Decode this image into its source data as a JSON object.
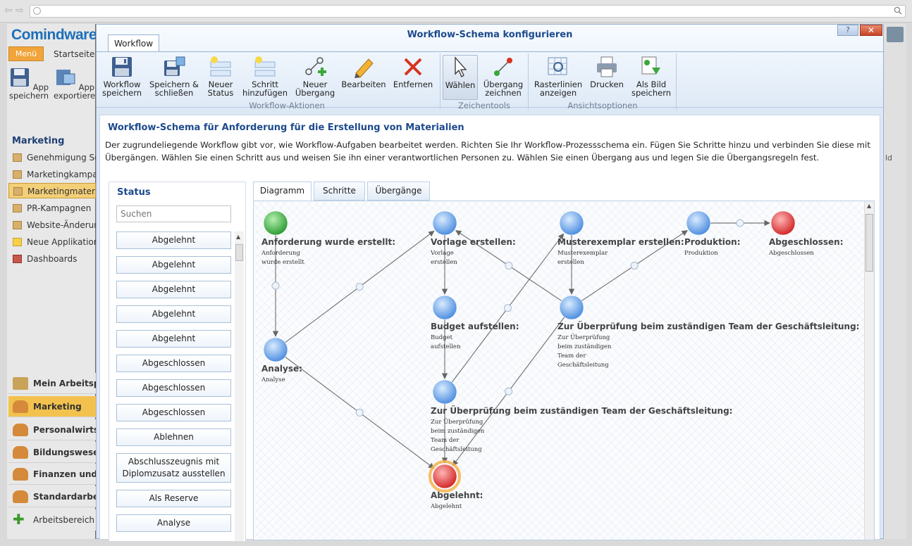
{
  "browser": {
    "url": ""
  },
  "bgapp": {
    "logo": "Comindware",
    "menu_tab": "Menü",
    "start_tab": "Startseite",
    "tools": [
      "App speichern",
      "App exportieren"
    ],
    "section_title": "Marketing",
    "nav_items": [
      "Genehmigung So",
      "Marketingkampa",
      "Marketingmateri",
      "PR-Kampagnen",
      "Website-Änderun",
      "Neue Applikation",
      "Dashboards"
    ],
    "bottom_items": [
      "Mein Arbeitsp",
      "Marketing",
      "Personalwirts",
      "Bildungswese",
      "Finanzen und",
      "Standardarbe",
      "Arbeitsbereich"
    ],
    "right_partial": "ld"
  },
  "dialog": {
    "title": "Workflow-Schema konfigurieren",
    "help_label": "?",
    "close_label": "✕",
    "ribbon_tab": "Workflow",
    "ribbon": {
      "groups": [
        "Workflow-Aktionen",
        "Zeichentools",
        "Ansichtsoptionen"
      ],
      "buttons": [
        [
          "Workflow",
          "speichern"
        ],
        [
          "Speichern &",
          "schließen"
        ],
        [
          "Neuer",
          "Status"
        ],
        [
          "Schritt",
          "hinzufügen"
        ],
        [
          "Neuer",
          "Übergang"
        ],
        [
          "Bearbeiten",
          ""
        ],
        [
          "Entfernen",
          ""
        ],
        [
          "Wählen",
          ""
        ],
        [
          "Übergang",
          "zeichnen"
        ],
        [
          "Rasterlinien",
          "anzeigen"
        ],
        [
          "Drucken",
          ""
        ],
        [
          "Als Bild",
          "speichern"
        ]
      ]
    },
    "content_title": "Workflow-Schema für Anforderung für die Erstellung von Materialien",
    "content_desc": "Der zugrundeliegende Workflow gibt vor, wie Workflow-Aufgaben bearbeitet werden. Richten Sie Ihr Workflow-Prozessschema ein. Fügen Sie Schritte hinzu und verbinden Sie diese mit Übergängen. Wählen Sie einen Schritt aus und weisen Sie ihn einer verantwortlichen Personen zu. Wählen Sie einen Übergang aus und legen Sie die Übergangsregeln fest.",
    "status_panel": {
      "title": "Status",
      "search_placeholder": "Suchen",
      "items": [
        "Abgelehnt",
        "Abgelehnt",
        "Abgelehnt",
        "Abgelehnt",
        "Abgelehnt",
        "Abgeschlossen",
        "Abgeschlossen",
        "Abgeschlossen",
        "Ablehnen",
        "Abschlusszeugnis mit Diplomzusatz ausstellen",
        "Als Reserve",
        "Analyse"
      ]
    },
    "tabs": [
      "Diagramm",
      "Schritte",
      "Übergänge"
    ],
    "diagram": {
      "nodes": [
        {
          "label": "Anforderung wurde erstellt:",
          "sub": [
            "Anforderung",
            "wurde erstellt"
          ],
          "kind": "start"
        },
        {
          "label": "Vorlage erstellen:",
          "sub": [
            "Vorlage",
            "erstellen"
          ],
          "kind": "step"
        },
        {
          "label": "Musterexemplar erstellen:",
          "sub": [
            "Musterexemplar",
            "erstellen"
          ],
          "kind": "step"
        },
        {
          "label": "Produktion:",
          "sub": [
            "Produktion"
          ],
          "kind": "step"
        },
        {
          "label": "Abgeschlossen:",
          "sub": [
            "Abgeschlossen"
          ],
          "kind": "end"
        },
        {
          "label": "Budget aufstellen:",
          "sub": [
            "Budget",
            "aufstellen"
          ],
          "kind": "step"
        },
        {
          "label": "Zur Überprüfung beim zuständigen Team der Geschäftsleitung:",
          "sub": [
            "Zur Überprüfung",
            "beim zuständigen",
            "Team der",
            "Geschäftsleitung"
          ],
          "kind": "step"
        },
        {
          "label": "Analyse:",
          "sub": [
            "Analyse"
          ],
          "kind": "step"
        },
        {
          "label": "Zur Überprüfung beim zuständigen Team der Geschäftsleitung:",
          "sub": [
            "Zur Überprüfung",
            "beim zuständigen",
            "Team der",
            "Geschäftsleitung"
          ],
          "kind": "step"
        },
        {
          "label": "Abgelehnt:",
          "sub": [
            "Abgelehnt"
          ],
          "kind": "rejected"
        }
      ]
    }
  }
}
